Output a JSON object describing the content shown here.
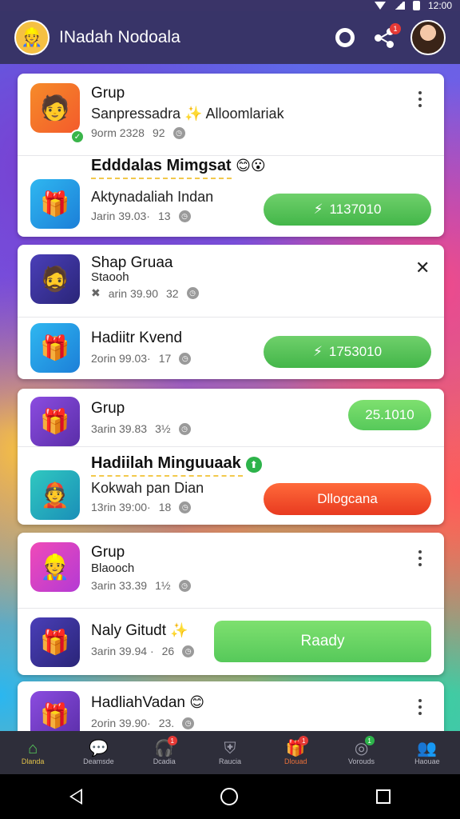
{
  "status_bar": {
    "time": "12:00"
  },
  "app_bar": {
    "title": "INadah Nodoala",
    "share_badge": "1"
  },
  "cards": [
    {
      "rows": [
        {
          "title": "Grup",
          "subtitle": "Sanpressadra",
          "subtitle_extra": "Alloomlariak",
          "meta_time": "9orm 2328",
          "meta_count": "92"
        },
        {
          "title": "Edddalas Mimgsat",
          "subtitle": "Aktynadaliah Indan",
          "meta_time": "Jarin 39.03·",
          "meta_count": "13",
          "button": "1137010"
        }
      ]
    },
    {
      "rows": [
        {
          "title": "Shap Gruaa",
          "subtitle": "Staooh",
          "meta_time": "arin 39.90",
          "meta_count": "32"
        },
        {
          "title": "Hadiitr Kvend",
          "meta_time": "2orin 99.03·",
          "meta_count": "17",
          "button": "1753010"
        }
      ]
    },
    {
      "rows": [
        {
          "title": "Grup",
          "meta_time": "3arin 39.83",
          "meta_count": "3½",
          "button": "25.1010"
        },
        {
          "title": "Hadiilah Minguuaak",
          "subtitle": "Kokwah pan Dian",
          "meta_time": "13rin 39:00·",
          "meta_count": "18",
          "button": "Dllogcana"
        }
      ]
    },
    {
      "rows": [
        {
          "title": "Grup",
          "subtitle": "Blaooch",
          "meta_time": "3arin 33.39",
          "meta_count": "1½"
        },
        {
          "title": "Naly Gitudt",
          "meta_time": "3arin 39.94 ·",
          "meta_count": "26",
          "button": "Raady"
        }
      ]
    },
    {
      "rows": [
        {
          "title": "HadliahVadan",
          "meta_time": "2orin 39.90·",
          "meta_count": "23."
        }
      ]
    }
  ],
  "bottom_nav": [
    {
      "label": "Dlanda",
      "icon": "home-icon",
      "badge": ""
    },
    {
      "label": "Deamsde",
      "icon": "chat-icon",
      "badge": ""
    },
    {
      "label": "Dcadia",
      "icon": "headset-icon",
      "badge": "1"
    },
    {
      "label": "Raucia",
      "icon": "shield-icon",
      "badge": ""
    },
    {
      "label": "Dlouad",
      "icon": "gift-icon",
      "badge": "1"
    },
    {
      "label": "Vorouds",
      "icon": "globe-icon",
      "badge": "1"
    },
    {
      "label": "Haouae",
      "icon": "users-icon",
      "badge": ""
    }
  ]
}
